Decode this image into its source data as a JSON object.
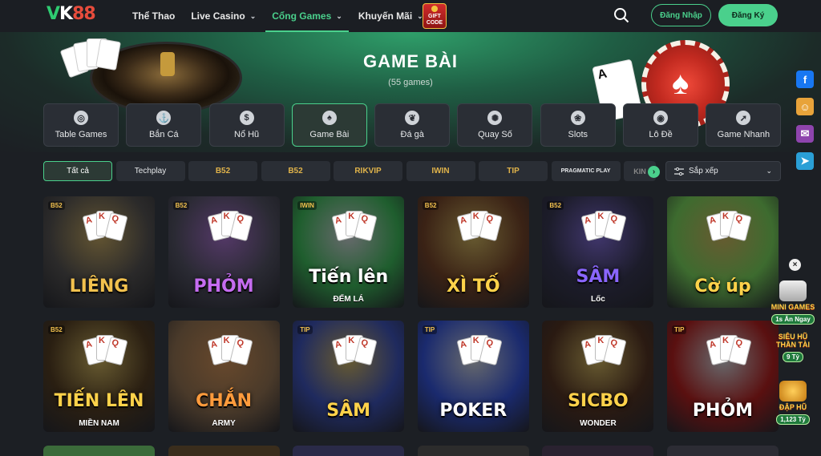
{
  "header": {
    "logo_text_v": "V",
    "logo_text_k": "K",
    "logo_text_88": "88",
    "nav": [
      {
        "label": "Thể Thao",
        "has_chevron": false
      },
      {
        "label": "Live Casino",
        "has_chevron": true
      },
      {
        "label": "Cổng Games",
        "has_chevron": true,
        "active": true
      },
      {
        "label": "Khuyến Mãi",
        "has_chevron": true
      }
    ],
    "gift_code": "GIFT CODE",
    "login_label": "Đăng Nhập",
    "register_label": "Đăng Ký",
    "accent_color": "#4ad08c"
  },
  "banner": {
    "title": "GAME BÀI",
    "count": "(55 games)"
  },
  "categories": [
    {
      "label": "Table Games",
      "icon": "chip-icon"
    },
    {
      "label": "Bắn Cá",
      "icon": "fish-icon"
    },
    {
      "label": "Nổ Hũ",
      "icon": "money-bag-icon"
    },
    {
      "label": "Game Bài",
      "icon": "card-spade-icon",
      "active": true
    },
    {
      "label": "Đá gà",
      "icon": "rooster-icon"
    },
    {
      "label": "Quay Số",
      "icon": "lottery-ball-icon"
    },
    {
      "label": "Slots",
      "icon": "cherry-icon"
    },
    {
      "label": "Lô Đề",
      "icon": "lottery-ticket-icon"
    },
    {
      "label": "Game Nhanh",
      "icon": "rocket-icon"
    }
  ],
  "providers": [
    {
      "label": "Tất cả",
      "active": true
    },
    {
      "label": "Techplay"
    },
    {
      "label": "B52"
    },
    {
      "label": "B52"
    },
    {
      "label": "RIKVIP"
    },
    {
      "label": "IWIN"
    },
    {
      "label": "TIP"
    },
    {
      "label": "PRAGMATIC PLAY"
    },
    {
      "label": "KIN"
    }
  ],
  "sort_label": "Sắp xếp",
  "games_row1": [
    {
      "name": "LIÊNG",
      "provider": "B52",
      "bg": "#2b2a2a",
      "accent": "#f2c14e"
    },
    {
      "name": "PHỎM",
      "provider": "B52",
      "bg": "#2a2a33",
      "accent": "#c56cf0"
    },
    {
      "name": "Tiến lên",
      "sub": "ĐẾM LÁ",
      "provider": "IWIN",
      "bg": "#1f5e2e",
      "accent": "#ffffff"
    },
    {
      "name": "XÌ TỐ",
      "provider": "B52",
      "bg": "#3a2215",
      "accent": "#ffd24a"
    },
    {
      "name": "SÂM",
      "sub": "Lốc",
      "provider": "B52",
      "bg": "#1c1c2a",
      "accent": "#8a66ff"
    },
    {
      "name": "Cờ úp",
      "provider": "",
      "bg": "#3d6b2f",
      "accent": "#ffd24a"
    }
  ],
  "games_row2": [
    {
      "name": "TIẾN LÊN",
      "sub": "MIỀN NAM",
      "provider": "B52",
      "bg": "#2a1f12",
      "accent": "#ffd24a"
    },
    {
      "name": "CHẮN",
      "sub": "ARMY",
      "provider": "",
      "bg": "#4a3a2a",
      "accent": "#ff9b3c"
    },
    {
      "name": "SÂM",
      "provider": "TIP",
      "bg": "#1f2a5e",
      "accent": "#ffd24a"
    },
    {
      "name": "POKER",
      "provider": "TIP",
      "bg": "#1a2a6e",
      "accent": "#ffffff"
    },
    {
      "name": "SICBO",
      "sub": "WONDER",
      "provider": "",
      "bg": "#2a1a12",
      "accent": "#ffd24a"
    },
    {
      "name": "PHỎM",
      "provider": "TIP",
      "bg": "#5a1010",
      "accent": "#ffffff"
    }
  ],
  "floating": {
    "mini_games": "MINI GAMES",
    "mini_games_pill": "1s Ăn Ngay",
    "sieu_hu": "SIÊU HŨ THẦN TÀI",
    "sieu_hu_pill": "9 Tỷ",
    "dap_hu": "ĐẬP HŨ",
    "dap_hu_pill": "1,123 Tỷ"
  },
  "social": [
    {
      "icon": "facebook-icon",
      "color": "#1877f2",
      "glyph": "f"
    },
    {
      "icon": "support-icon",
      "color": "#e8a33a",
      "glyph": "☺"
    },
    {
      "icon": "messenger-icon",
      "color": "#8e44ad",
      "glyph": "✉"
    },
    {
      "icon": "telegram-icon",
      "color": "#2a9fd6",
      "glyph": "➤"
    }
  ]
}
